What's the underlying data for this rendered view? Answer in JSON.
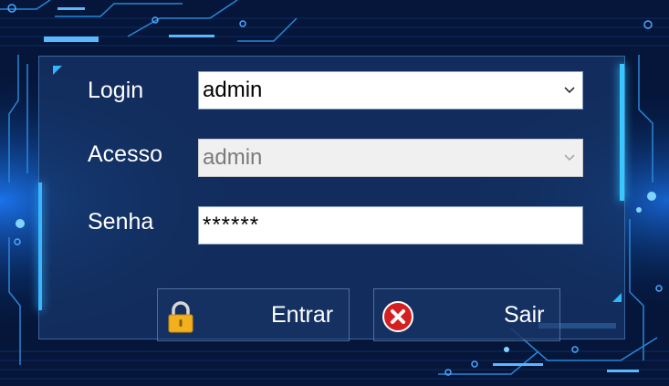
{
  "form": {
    "login_label": "Login",
    "login_value": "admin",
    "acesso_label": "Acesso",
    "acesso_value": "admin",
    "senha_label": "Senha",
    "senha_value": "******"
  },
  "buttons": {
    "entrar_label": "Entrar",
    "sair_label": "Sair"
  },
  "icons": {
    "login_dropdown": "chevron-down-icon",
    "acesso_dropdown": "chevron-down-icon",
    "entrar": "padlock-icon",
    "sair": "close-circle-icon"
  },
  "colors": {
    "background": "#05163a",
    "panel": "#163468",
    "accent": "#39b6ff",
    "padlock": "#f2b01e",
    "close": "#d42020"
  }
}
